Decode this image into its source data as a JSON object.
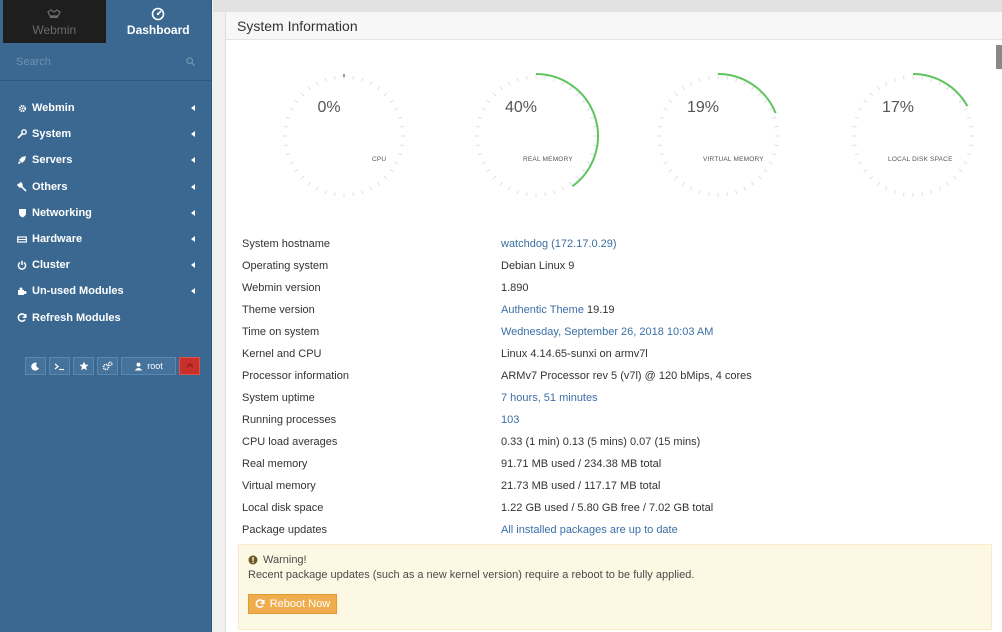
{
  "sidebar": {
    "tabs": [
      {
        "label": "Webmin",
        "icon": "webmin-logo-icon",
        "active": false
      },
      {
        "label": "Dashboard",
        "icon": "dashboard-icon",
        "active": true
      }
    ],
    "search": {
      "placeholder": "Search",
      "value": ""
    },
    "items": [
      {
        "label": "Webmin",
        "icon": "gear-icon"
      },
      {
        "label": "System",
        "icon": "wrench-icon"
      },
      {
        "label": "Servers",
        "icon": "rocket-icon"
      },
      {
        "label": "Others",
        "icon": "tools-icon"
      },
      {
        "label": "Networking",
        "icon": "shield-icon"
      },
      {
        "label": "Hardware",
        "icon": "hdd-icon"
      },
      {
        "label": "Cluster",
        "icon": "power-icon"
      },
      {
        "label": "Un-used Modules",
        "icon": "puzzle-icon"
      },
      {
        "label": "Refresh Modules",
        "icon": "refresh-icon"
      }
    ],
    "toolbar": {
      "buttons": [
        "night-mode-icon",
        "terminal-icon",
        "star-icon",
        "gears-icon"
      ],
      "user": "root",
      "logout_icon": "logout-icon"
    }
  },
  "panel": {
    "title": "System Information"
  },
  "gauges": [
    {
      "label": "CPU",
      "percent": 0,
      "display": "0%"
    },
    {
      "label": "REAL MEMORY",
      "percent": 40,
      "display": "40%"
    },
    {
      "label": "VIRTUAL MEMORY",
      "percent": 19,
      "display": "19%"
    },
    {
      "label": "LOCAL DISK SPACE",
      "percent": 17,
      "display": "17%"
    }
  ],
  "colors": {
    "sidebar": "#3a6891",
    "gauge_fill": "#5ec45e",
    "link": "#3b6fa5",
    "warning_bg": "#fcf8e3",
    "reboot_button": "#f0ad4e"
  },
  "info": [
    {
      "key": "System hostname",
      "value": "watchdog (172.17.0.29)",
      "link": true
    },
    {
      "key": "Operating system",
      "value": "Debian Linux 9",
      "link": false
    },
    {
      "key": "Webmin version",
      "value": "1.890",
      "link": false
    },
    {
      "key": "Theme version",
      "value": "Authentic Theme",
      "value2": " 19.19",
      "link": true
    },
    {
      "key": "Time on system",
      "value": "Wednesday, September 26, 2018 10:03 AM",
      "link": true
    },
    {
      "key": "Kernel and CPU",
      "value": "Linux 4.14.65-sunxi on armv7l",
      "link": false
    },
    {
      "key": "Processor information",
      "value": "ARMv7 Processor rev 5 (v7l) @ 120 bMips, 4 cores",
      "link": false
    },
    {
      "key": "System uptime",
      "value": "7 hours, 51 minutes",
      "link": true
    },
    {
      "key": "Running processes",
      "value": "103",
      "link": true
    },
    {
      "key": "CPU load averages",
      "value": "0.33 (1 min) 0.13 (5 mins) 0.07 (15 mins)",
      "link": false
    },
    {
      "key": "Real memory",
      "value": "91.71 MB used / 234.38 MB total",
      "link": false
    },
    {
      "key": "Virtual memory",
      "value": "21.73 MB used / 117.17 MB total",
      "link": false
    },
    {
      "key": "Local disk space",
      "value": "1.22 GB used / 5.80 GB free / 7.02 GB total",
      "link": false
    },
    {
      "key": "Package updates",
      "value": "All installed packages are up to date",
      "link": true
    }
  ],
  "warning": {
    "title": "Warning!",
    "message": "Recent package updates (such as a new kernel version) require a reboot to be fully applied.",
    "button": "Reboot Now"
  }
}
